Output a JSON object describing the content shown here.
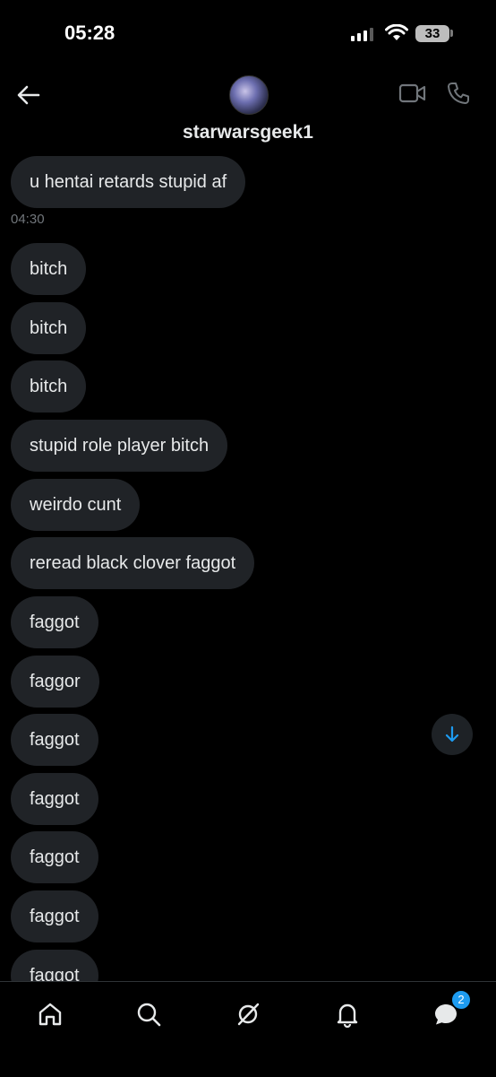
{
  "status_bar": {
    "time": "05:28",
    "battery": "33"
  },
  "header": {
    "username": "starwarsgeek1",
    "back_icon": "arrow-left-icon",
    "video_icon": "video-camera-icon",
    "phone_icon": "phone-icon"
  },
  "messages": [
    {
      "text": "u hentai retards stupid af"
    },
    {
      "text": "bitch"
    },
    {
      "text": "bitch"
    },
    {
      "text": "bitch"
    },
    {
      "text": "stupid role player bitch"
    },
    {
      "text": "weirdo cunt"
    },
    {
      "text": "reread black clover faggot"
    },
    {
      "text": "faggot"
    },
    {
      "text": "faggor"
    },
    {
      "text": "faggot"
    },
    {
      "text": "faggot"
    },
    {
      "text": "faggot"
    },
    {
      "text": "faggot"
    },
    {
      "text": "faggot"
    }
  ],
  "timestamp": "04:30",
  "tab_bar": {
    "items": [
      "home-icon",
      "search-icon",
      "grok-icon",
      "notifications-icon",
      "messages-icon"
    ],
    "messages_badge": "2"
  },
  "colors": {
    "background": "#000000",
    "bubble": "#202327",
    "accent": "#1d9bf0",
    "muted_text": "#71767b"
  }
}
